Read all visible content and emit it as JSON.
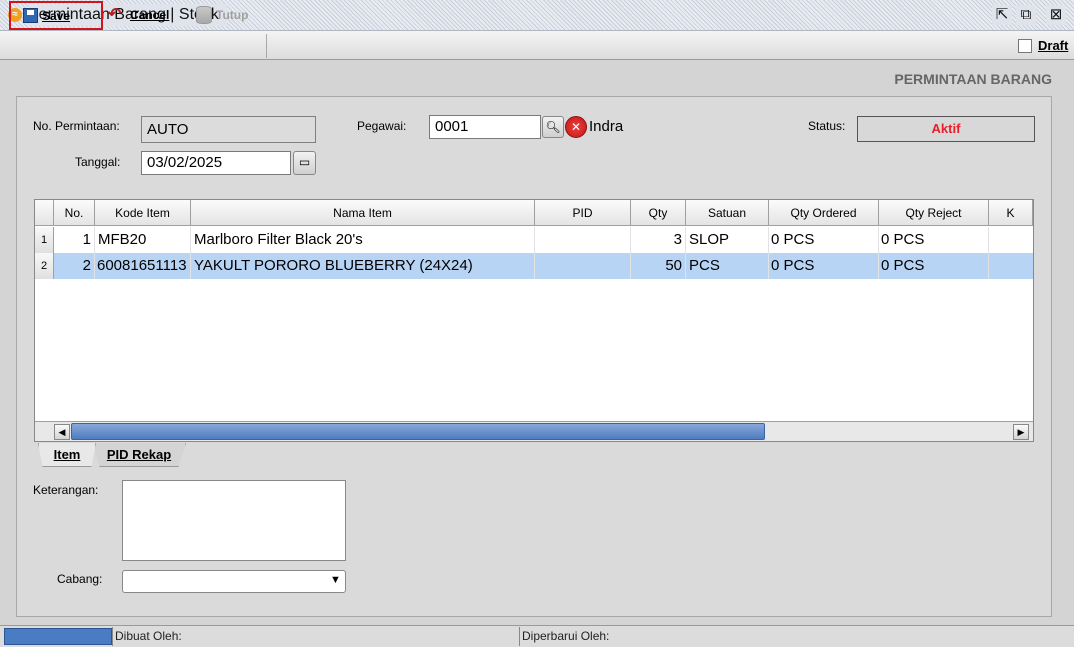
{
  "window": {
    "title": "Permintaan Barang | Stock",
    "icon": "app-icon",
    "buttons": [
      "restore-icon",
      "maximize-icon",
      "close-icon"
    ]
  },
  "toolbar": {
    "save_label": "Save",
    "cancel_label": "Cancel",
    "tutup_label": "Tutup",
    "draft_label": "Draft",
    "draft_checked": false
  },
  "section_title": "PERMINTAAN BARANG",
  "form": {
    "no_permintaan_label": "No. Permintaan:",
    "no_permintaan_value": "AUTO",
    "tanggal_label": "Tanggal:",
    "tanggal_value": "03/02/2025",
    "pegawai_label": "Pegawai:",
    "pegawai_value": "0001",
    "pegawai_name": "Indra",
    "status_label": "Status:",
    "status_value": "Aktif",
    "keterangan_label": "Keterangan:",
    "keterangan_value": "",
    "cabang_label": "Cabang:",
    "cabang_value": ""
  },
  "grid": {
    "columns": [
      "No.",
      "Kode Item",
      "Nama Item",
      "PID",
      "Qty",
      "Satuan",
      "Qty Ordered",
      "Qty Reject",
      "K"
    ],
    "rows": [
      {
        "rownum": "1",
        "no": "1",
        "kode": "MFB20",
        "nama": "Marlboro Filter Black 20's",
        "pid": "",
        "qty": "3",
        "satuan": "SLOP",
        "qty_ordered": "0 PCS",
        "qty_reject": "0 PCS",
        "selected": false
      },
      {
        "rownum": "2",
        "no": "2",
        "kode": "60081651113",
        "nama": "YAKULT PORORO BLUEBERRY (24X24)",
        "pid": "",
        "qty": "50",
        "satuan": "PCS",
        "qty_ordered": "0 PCS",
        "qty_reject": "0 PCS",
        "selected": true
      }
    ]
  },
  "tabs": [
    {
      "label": "Item",
      "active": true
    },
    {
      "label": "PID Rekap",
      "active": false
    }
  ],
  "statusbar": {
    "dibuat_label": "Dibuat Oleh:",
    "diperbarui_label": "Diperbarui Oleh:"
  },
  "colors": {
    "status_text": "#e8202a",
    "selected_row": "#b8d4f4",
    "save_highlight": "#d2141c"
  }
}
